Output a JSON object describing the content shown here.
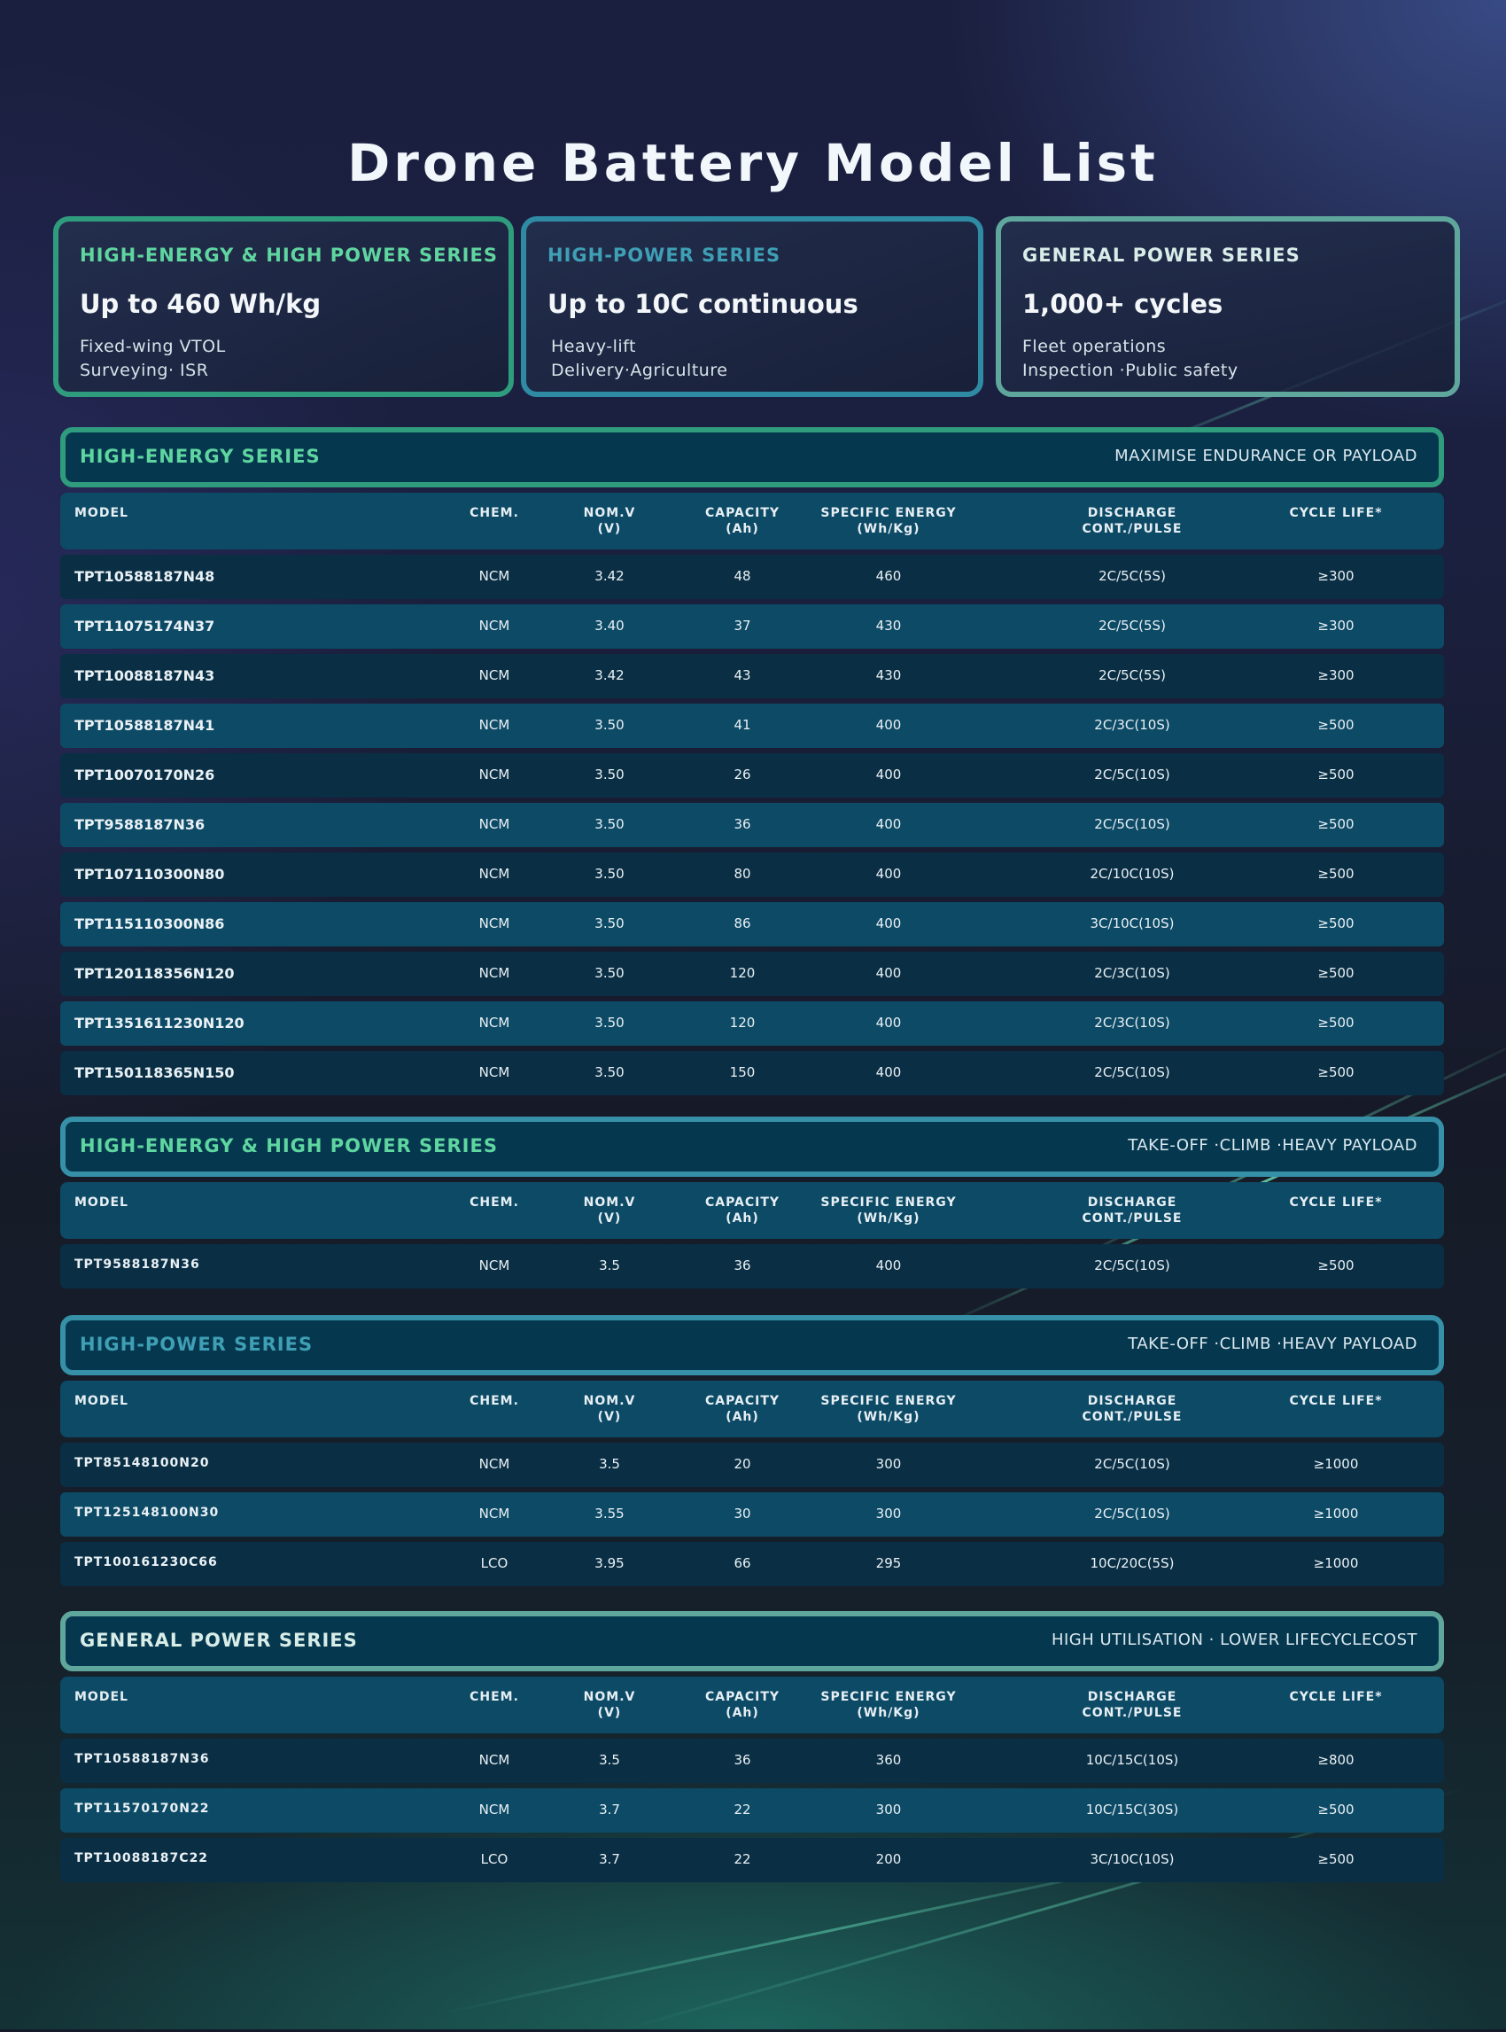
{
  "title": "Drone Battery Model List",
  "cards": [
    {
      "series": "HIGH-ENERGY & HIGH POWER SERIES",
      "headline": "Up to 460 Wh/kg",
      "line1": "Fixed-wing VTOL",
      "line2": "Surveying· ISR",
      "color": "#5fd6a0",
      "border": "#2f9c7e"
    },
    {
      "series": "HIGH-POWER SERIES",
      "headline": "Up to 10C continuous",
      "line1": "Heavy-lift",
      "line2": "Delivery·Agriculture",
      "color": "#3f9fb5",
      "border": "#2f8aa4"
    },
    {
      "series": "GENERAL  POWER  SERIES",
      "headline": "1,000+ cycles",
      "line1": "Fleet operations",
      "line2": "Inspection ·Public safety",
      "color": "#d8ece8",
      "border": "#5fa79d"
    }
  ],
  "columns": {
    "model": "MODEL",
    "chem": "CHEM.",
    "nomv": "NOM.V",
    "nomv_unit": "(V)",
    "capacity": "CAPACITY",
    "capacity_unit": "(Ah)",
    "specific": "SPECIFIC ENERGY",
    "specific_unit": "(Wh/Kg)",
    "discharge": "DISCHARGE",
    "discharge_sub": "CONT./PULSE",
    "cycle": "CYCLE LIFE*"
  },
  "sections": [
    {
      "name": "HIGH-ENERGY  SERIES",
      "tagline": "MAXIMISE ENDURANCE OR PAYLOAD",
      "color": "#5fd6a0",
      "border": "#2f9c7e",
      "rows": [
        [
          "TPT10588187N48",
          "NCM",
          "3.42",
          "48",
          "460",
          "2C/5C(5S)",
          "≥300"
        ],
        [
          "TPT11075174N37",
          "NCM",
          "3.40",
          "37",
          "430",
          "2C/5C(5S)",
          "≥300"
        ],
        [
          "TPT10088187N43",
          "NCM",
          "3.42",
          "43",
          "430",
          "2C/5C(5S)",
          "≥300"
        ],
        [
          "TPT10588187N41",
          "NCM",
          "3.50",
          "41",
          "400",
          "2C/3C(10S)",
          "≥500"
        ],
        [
          "TPT10070170N26",
          "NCM",
          "3.50",
          "26",
          "400",
          "2C/5C(10S)",
          "≥500"
        ],
        [
          "TPT9588187N36",
          "NCM",
          "3.50",
          "36",
          "400",
          "2C/5C(10S)",
          "≥500"
        ],
        [
          "TPT107110300N80",
          "NCM",
          "3.50",
          "80",
          "400",
          "2C/10C(10S)",
          "≥500"
        ],
        [
          "TPT115110300N86",
          "NCM",
          "3.50",
          "86",
          "400",
          "3C/10C(10S)",
          "≥500"
        ],
        [
          "TPT120118356N120",
          "NCM",
          "3.50",
          "120",
          "400",
          "2C/3C(10S)",
          "≥500"
        ],
        [
          "TPT1351611230N120",
          "NCM",
          "3.50",
          "120",
          "400",
          "2C/3C(10S)",
          "≥500"
        ],
        [
          "TPT150118365N150",
          "NCM",
          "3.50",
          "150",
          "400",
          "2C/5C(10S)",
          "≥500"
        ]
      ]
    },
    {
      "name": "HIGH-ENERGY & HIGH POWER SERIES",
      "tagline": "TAKE-OFF ·CLIMB ·HEAVY PAYLOAD",
      "color": "#5fd6a0",
      "border": "#3590a8",
      "rows": [
        [
          "TPT9588187N36",
          "NCM",
          "3.5",
          "36",
          "400",
          "2C/5C(10S)",
          "≥500"
        ]
      ]
    },
    {
      "name": "HIGH-POWER SERIES",
      "tagline": "TAKE-OFF ·CLIMB ·HEAVY PAYLOAD",
      "color": "#3f9fb5",
      "border": "#3590a8",
      "rows": [
        [
          "TPT85148100N20",
          "NCM",
          "3.5",
          "20",
          "300",
          "2C/5C(10S)",
          "≥1000"
        ],
        [
          "TPT125148100N30",
          "NCM",
          "3.55",
          "30",
          "300",
          "2C/5C(10S)",
          "≥1000"
        ],
        [
          "TPT100161230C66",
          "LCO",
          "3.95",
          "66",
          "295",
          "10C/20C(5S)",
          "≥1000"
        ]
      ]
    },
    {
      "name": "GENERAL  POWER  SERIES",
      "tagline": "HIGH UTILISATION · LOWER LIFECYCLECOST",
      "color": "#d8ece8",
      "border": "#5fa79d",
      "rows": [
        [
          "TPT10588187N36",
          "NCM",
          "3.5",
          "36",
          "360",
          "10C/15C(10S)",
          "≥800"
        ],
        [
          "TPT11570170N22",
          "NCM",
          "3.7",
          "22",
          "300",
          "10C/15C(30S)",
          "≥500"
        ],
        [
          "TPT10088187C22",
          "LCO",
          "3.7",
          "22",
          "200",
          "3C/10C(10S)",
          "≥500"
        ]
      ]
    }
  ]
}
